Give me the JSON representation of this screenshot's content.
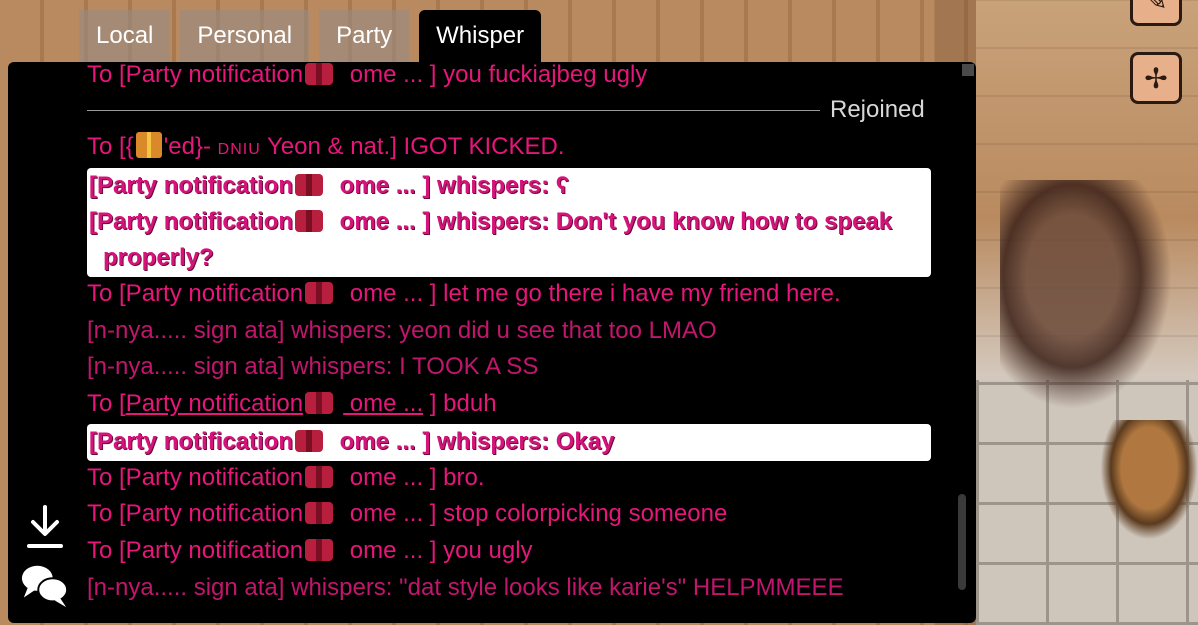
{
  "tabs": [
    {
      "label": "Local"
    },
    {
      "label": "Personal"
    },
    {
      "label": "Party"
    },
    {
      "label": "Whisper"
    }
  ],
  "active_tab": "Whisper",
  "separator": {
    "label": "Rejoined"
  },
  "messages": [
    {
      "text_a": "To [Party notification",
      "text_b": " ome ... ] you fuckiajbeg ugly",
      "highlight": false
    },
    {
      "text_a": "To [{",
      "gift": true,
      "text_b": "'ed}- ",
      "small": "DNIU",
      "text_c": " Yeon & nat.] IGOT KICKED.",
      "highlight": false
    },
    {
      "text_a": "[Party notification",
      "text_b": " ome ... ] whispers: ʕ",
      "highlight": true
    },
    {
      "text_a": "[Party notification",
      "text_b": " ome ... ] whispers: Don't you know how to speak",
      "cont": "properly?",
      "highlight": true
    },
    {
      "text_a": "To [Party notification",
      "text_b": " ome ... ] let me go there i have my friend here.",
      "highlight": false
    },
    {
      "text": "[n-nya..... sign ata] whispers: yeon did u see that too LMAO",
      "highlight": false
    },
    {
      "text": "[n-nya..... sign ata] whispers: I TOOK A SS",
      "highlight": false
    },
    {
      "text_a": "To [",
      "link_a": "Party notification",
      "link_b": " ome ...",
      "text_b": " ] bduh",
      "highlight": false
    },
    {
      "text_a": "[Party notification",
      "text_b": " ome ... ] whispers: Okay",
      "highlight": true
    },
    {
      "text_a": "To [Party notification",
      "text_b": " ome ... ] bro.",
      "highlight": false
    },
    {
      "text_a": "To [Party notification",
      "text_b": " ome ... ] stop colorpicking someone",
      "highlight": false
    },
    {
      "text_a": "To [Party notification",
      "text_b": " ome ... ] you ugly",
      "highlight": false
    },
    {
      "text": "[n-nya..... sign ata] whispers: \"dat style looks like karie's\" HELPMMEEE",
      "highlight": false
    }
  ],
  "side_buttons": [
    {
      "icon": "download-icon"
    },
    {
      "icon": "chat-bubbles-icon"
    }
  ],
  "colors": {
    "message": "#e6167a",
    "highlight_bg": "#ffffff",
    "panel_bg": "#000000"
  }
}
